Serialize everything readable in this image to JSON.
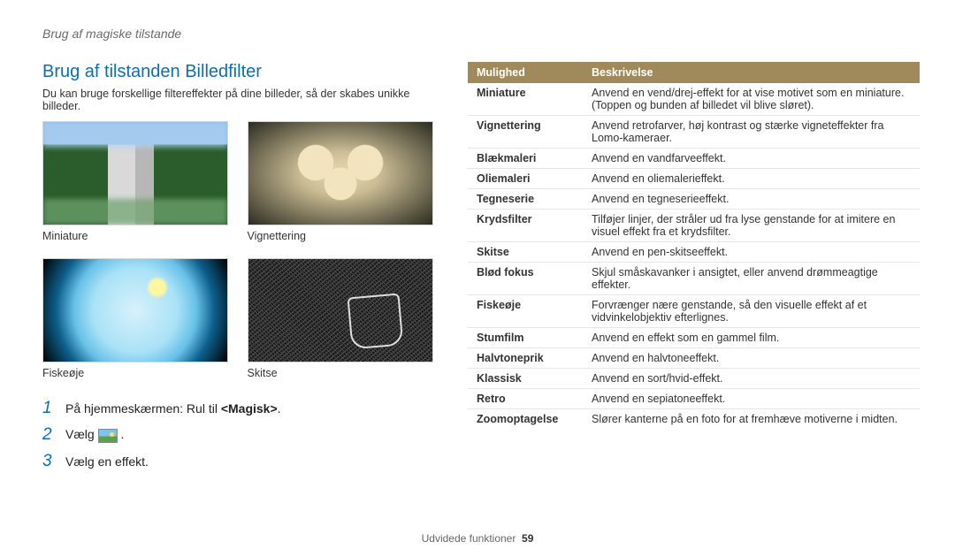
{
  "breadcrumb": "Brug af magiske tilstande",
  "heading": "Brug af tilstanden Billedfilter",
  "intro": "Du kan bruge forskellige filtereffekter på dine billeder, så der skabes unikke billeder.",
  "thumbs": {
    "miniature": "Miniature",
    "vignette": "Vignettering",
    "fisheye": "Fiskeøje",
    "sketch": "Skitse"
  },
  "steps": {
    "s1_pre": "På hjemmeskærmen: Rul til ",
    "s1_bold": "<Magisk>",
    "s1_post": ".",
    "s2": "Vælg ",
    "s2_post": ".",
    "s3": "Vælg en effekt."
  },
  "table": {
    "head_opt": "Mulighed",
    "head_desc": "Beskrivelse",
    "rows": [
      {
        "opt": "Miniature",
        "desc": "Anvend en vend/drej-effekt for at vise motivet som en miniature. (Toppen og bunden af billedet vil blive sløret)."
      },
      {
        "opt": "Vignettering",
        "desc": "Anvend retrofarver, høj kontrast og stærke vigneteffekter fra Lomo-kameraer."
      },
      {
        "opt": "Blækmaleri",
        "desc": "Anvend en vandfarveeffekt."
      },
      {
        "opt": "Oliemaleri",
        "desc": "Anvend en oliemalerieffekt."
      },
      {
        "opt": "Tegneserie",
        "desc": "Anvend en tegneserieeffekt."
      },
      {
        "opt": "Krydsfilter",
        "desc": "Tilføjer linjer, der stråler ud fra lyse genstande for at imitere en visuel effekt fra et krydsfilter."
      },
      {
        "opt": "Skitse",
        "desc": "Anvend en pen-skitseeffekt."
      },
      {
        "opt": "Blød fokus",
        "desc": "Skjul småskavanker i ansigtet, eller anvend drømmeagtige effekter."
      },
      {
        "opt": "Fiskeøje",
        "desc": "Forvrænger nære genstande, så den visuelle effekt af et vidvinkelobjektiv efterlignes."
      },
      {
        "opt": "Stumfilm",
        "desc": "Anvend en effekt som en gammel film."
      },
      {
        "opt": "Halvtoneprik",
        "desc": "Anvend en halvtoneeffekt."
      },
      {
        "opt": "Klassisk",
        "desc": "Anvend en sort/hvid-effekt."
      },
      {
        "opt": "Retro",
        "desc": "Anvend en sepiatoneeffekt."
      },
      {
        "opt": "Zoomoptagelse",
        "desc": "Slører kanterne på en foto for at fremhæve motiverne i midten."
      }
    ]
  },
  "footer": {
    "label": "Udvidede funktioner",
    "page": "59"
  }
}
